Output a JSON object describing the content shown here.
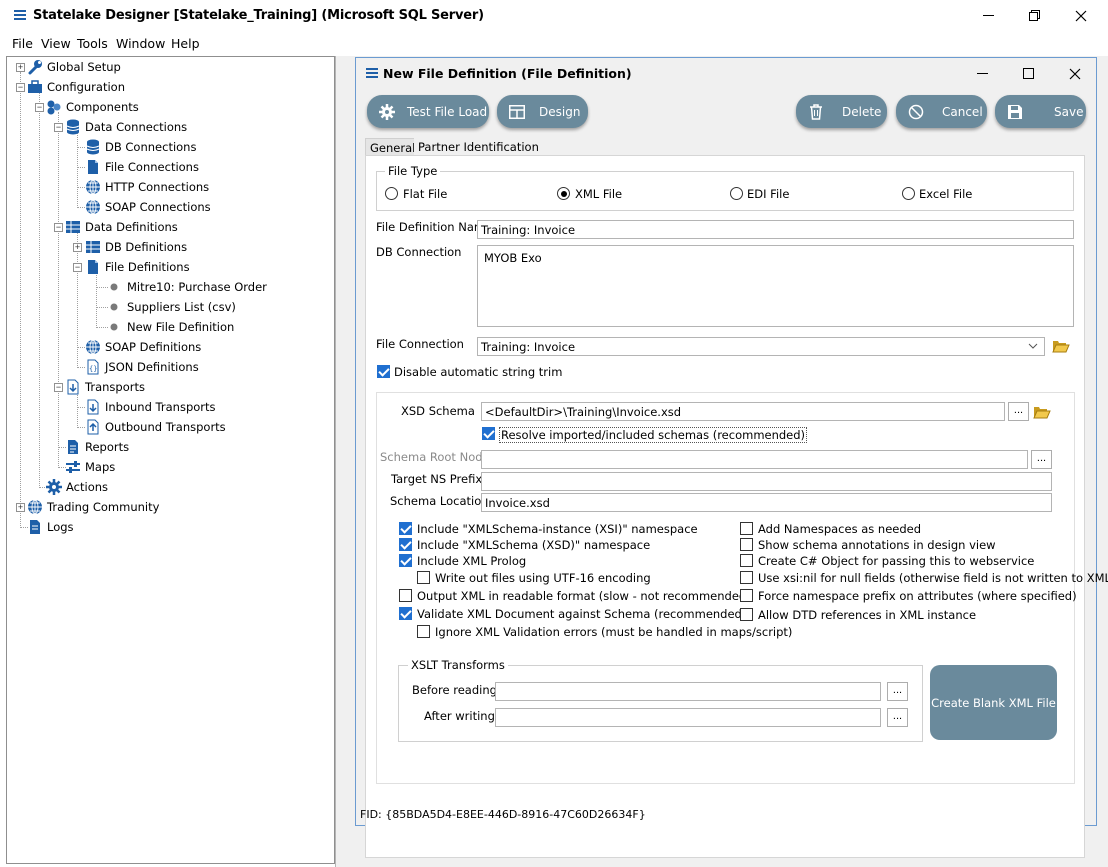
{
  "window": {
    "title": "Statelake Designer [Statelake_Training] (Microsoft SQL Server)"
  },
  "menu": [
    "File",
    "View",
    "Tools",
    "Window",
    "Help"
  ],
  "tree": {
    "items": [
      "Global Setup",
      "Configuration",
      "Components",
      "Data Connections",
      "DB Connections",
      "File Connections",
      "HTTP Connections",
      "SOAP Connections",
      "Data Definitions",
      "DB Definitions",
      "File Definitions",
      "Mitre10: Purchase Order",
      "Suppliers List (csv)",
      "New File Definition",
      "SOAP Definitions",
      "JSON Definitions",
      "Transports",
      "Inbound Transports",
      "Outbound Transports",
      "Reports",
      "Maps",
      "Actions",
      "Trading Community",
      "Logs"
    ]
  },
  "child": {
    "title": "New File Definition (File Definition)",
    "toolbar": {
      "test": "Test File Load",
      "design": "Design",
      "delete": "Delete",
      "cancel": "Cancel",
      "save": "Save"
    },
    "tabs": [
      "General",
      "Partner Identification"
    ],
    "file_type": {
      "label": "File Type",
      "options": [
        "Flat File",
        "XML File",
        "EDI File",
        "Excel File"
      ],
      "selected": "XML File"
    },
    "file_definition_name": {
      "label": "File Definition Name",
      "value": "Training: Invoice"
    },
    "db_connection": {
      "label": "DB Connection",
      "value": "MYOB Exo"
    },
    "file_connection": {
      "label": "File Connection",
      "value": "Training: Invoice"
    },
    "disable_trim": {
      "label": "Disable automatic string trim",
      "checked": true
    },
    "xsd": {
      "schema_label": "XSD Schema",
      "schema_value": "<DefaultDir>\\Training\\Invoice.xsd",
      "resolve_label": "Resolve imported/included schemas (recommended)",
      "resolve_checked": true,
      "root_label": "Schema Root Node",
      "root_value": "",
      "ns_label": "Target NS Prefix",
      "ns_value": "",
      "loc_label": "Schema Location",
      "loc_value": "Invoice.xsd"
    },
    "options_left": [
      {
        "label": "Include \"XMLSchema-instance (XSI)\" namespace",
        "checked": true
      },
      {
        "label": "Include \"XMLSchema (XSD)\" namespace",
        "checked": true
      },
      {
        "label": "Include XML Prolog",
        "checked": true
      },
      {
        "label": "Write out files using UTF-16 encoding",
        "checked": false
      },
      {
        "label": "Output XML in readable format (slow - not recommended)",
        "checked": false
      },
      {
        "label": "Validate XML Document against Schema (recommended)",
        "checked": true
      },
      {
        "label": "Ignore XML Validation errors (must be handled in maps/script)",
        "checked": false
      }
    ],
    "options_right": [
      {
        "label": "Add Namespaces as needed",
        "checked": false
      },
      {
        "label": "Show schema annotations in design view",
        "checked": false
      },
      {
        "label": "Create C# Object for passing this to webservice",
        "checked": false
      },
      {
        "label": "Use xsi:nil for null fields (otherwise field is not written to XML)",
        "checked": false
      },
      {
        "label": "Force namespace prefix on attributes (where specified)",
        "checked": false
      },
      {
        "label": "Allow DTD references in XML instance",
        "checked": false
      }
    ],
    "xslt": {
      "label": "XSLT Transforms",
      "before": "Before reading",
      "after": "After writing",
      "before_value": "",
      "after_value": ""
    },
    "create_blank": "Create Blank XML File",
    "dots": "...",
    "fid": "FID: {85BDA5D4-E8EE-446D-8916-47C60D26634F}"
  },
  "colors": {
    "toolbar_button": "#6a8a9c",
    "create_button": "#6a8a9c",
    "check_blue": "#1f6fd0"
  }
}
